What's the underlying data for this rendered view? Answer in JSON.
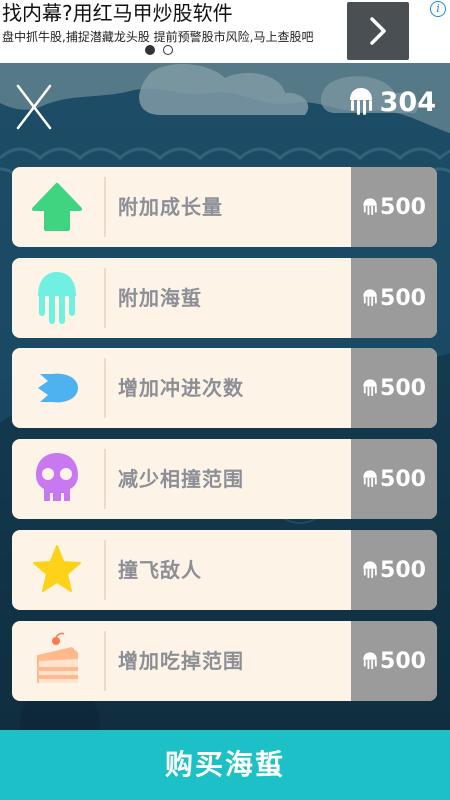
{
  "ad": {
    "title": "找内幕?用红马甲炒股软件",
    "subtitle": "盘中抓牛股,捕捉潜藏龙头股 提前预警股市风险,马上查股吧",
    "next_icon": "chevron-right-icon",
    "info_icon": "info-icon",
    "info_glyph": "i"
  },
  "header": {
    "close_icon": "close-x-icon",
    "currency_icon": "jellyfish-icon",
    "jellyfish_count": "304"
  },
  "items": [
    {
      "label": "附加成长量",
      "price": "500",
      "icon": "arrow-up-icon",
      "color": "#3fd47f"
    },
    {
      "label": "附加海蜇",
      "price": "500",
      "icon": "jellyfish-icon",
      "color": "#6ff0e0"
    },
    {
      "label": "增加冲进次数",
      "price": "500",
      "icon": "dash-blob-icon",
      "color": "#4fb2f0"
    },
    {
      "label": "减少相撞范围",
      "price": "500",
      "icon": "skull-icon",
      "color": "#c879f0"
    },
    {
      "label": "撞飞敌人",
      "price": "500",
      "icon": "star-icon",
      "color": "#ffd21a"
    },
    {
      "label": "增加吃掉范围",
      "price": "500",
      "icon": "cake-icon",
      "color": "#ffb98c"
    }
  ],
  "buy_button": {
    "label": "购买海蜇"
  },
  "colors": {
    "accent": "#1cc0c6",
    "price_bg": "#9b9b9b",
    "card_bg": "#fdf3e7"
  }
}
